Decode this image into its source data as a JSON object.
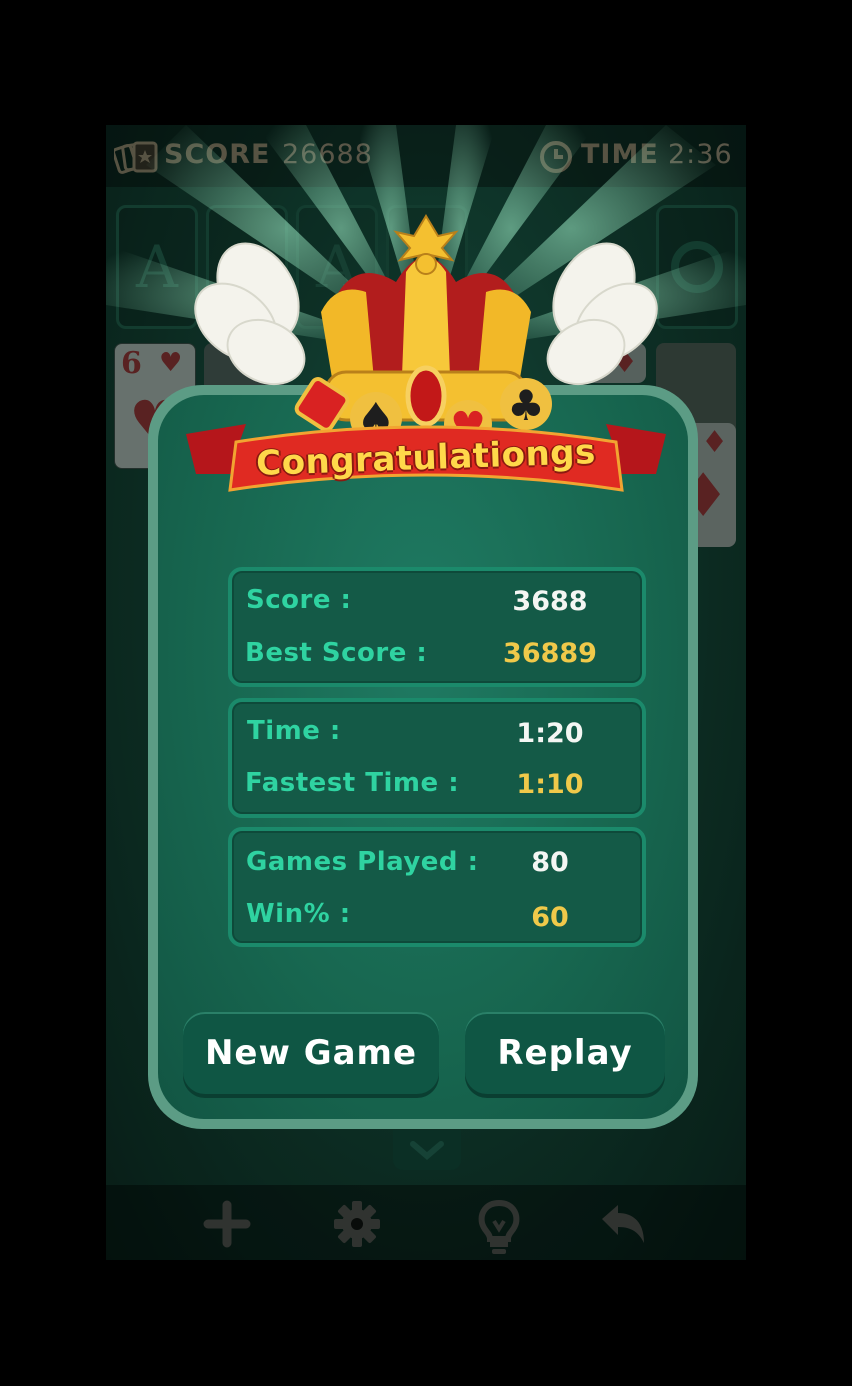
{
  "topbar": {
    "score_label": "SCORE",
    "score_value": "26688",
    "time_label": "TIME",
    "time_value": "2:36"
  },
  "tableau": {
    "foundation_letter": "A",
    "card_rank": "6"
  },
  "dialog": {
    "banner": "Congratulationgs",
    "stats": {
      "score_label": "Score :",
      "score_value": "3688",
      "best_label": "Best Score :",
      "best_value": "36889",
      "time_label": "Time :",
      "time_value": "1:20",
      "fastest_label": "Fastest Time :",
      "fastest_value": "1:10",
      "games_label": "Games Played :",
      "games_value": "80",
      "win_label": "Win% :",
      "win_value": "60"
    },
    "new_game_label": "New Game",
    "replay_label": "Replay"
  },
  "icons": {
    "cards": "cards-icon",
    "clock": "clock-icon",
    "add": "plus-icon",
    "settings": "gear-icon",
    "hint": "lightbulb-icon",
    "undo": "undo-icon",
    "chevron": "chevron-down-icon"
  },
  "colors": {
    "felt": "#17664f",
    "accent_gold": "#f0c94a",
    "label_green": "#2fd3a1",
    "ribbon_red": "#d4241c"
  }
}
